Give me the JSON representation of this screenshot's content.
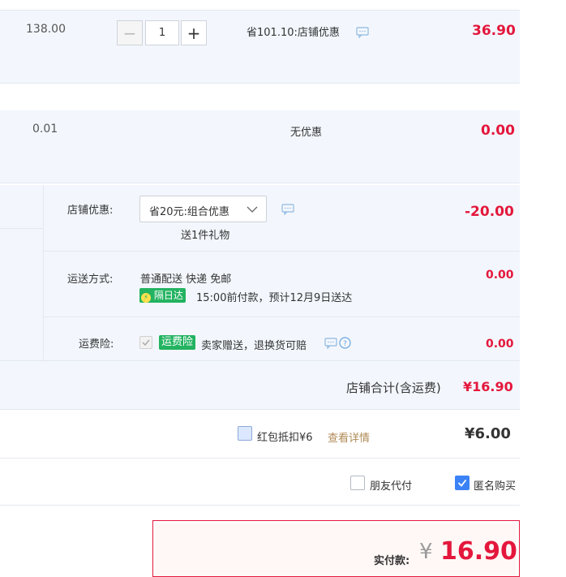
{
  "items": [
    {
      "unit_price": "138.00",
      "quantity": "1",
      "discount": "省101.10:店铺优惠",
      "subtotal": "36.90"
    },
    {
      "unit_price": "0.01",
      "discount": "无优惠",
      "subtotal": "0.00"
    }
  ],
  "store_discount": {
    "label": "店铺优惠:",
    "selected": "省20元:组合优惠",
    "gift": "送1件礼物",
    "amount": "-20.00"
  },
  "shipping": {
    "label": "运送方式:",
    "method": "普通配送 快递 免邮",
    "badge": "隔日达",
    "note": "15:00前付款，预计12月9日送达",
    "amount": "0.00"
  },
  "insurance": {
    "label": "运费险:",
    "badge": "运费险",
    "desc": "卖家赠送，退换货可赔",
    "amount": "0.00"
  },
  "store_total": {
    "label": "店铺合计(含运费)",
    "amount": "¥16.90"
  },
  "red_packet": {
    "label": "红包抵扣¥6",
    "link": "查看详情",
    "amount": "¥6.00"
  },
  "options": {
    "friend_pay": "朋友代付",
    "anonymous": "匿名购买"
  },
  "payment": {
    "label": "实付款:",
    "currency": "¥",
    "amount": "16.90"
  },
  "colors": {
    "accent_red": "#e4173c",
    "badge_green": "#23b361",
    "link_gold": "#b08a56",
    "checkbox_blue": "#3b82f6"
  }
}
